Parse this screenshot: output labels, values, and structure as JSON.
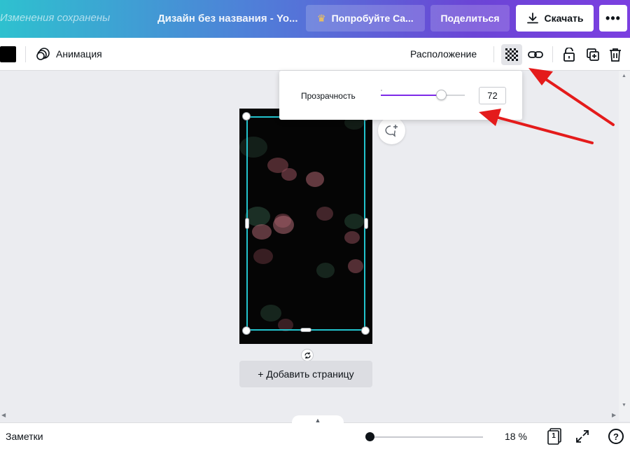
{
  "header": {
    "saved_status": "Изменения сохранены",
    "doc_title": "Дизайн без названия - Yo...",
    "try_button": "Попробуйте Ca...",
    "share_button": "Поделиться",
    "download_button": "Скачать",
    "more_button": "•••"
  },
  "toolbar": {
    "animation_label": "Анимация",
    "arrange_label": "Расположение"
  },
  "transparency_popup": {
    "label": "Прозрачность",
    "value": "72",
    "level": 0.72
  },
  "canvas": {
    "add_page_button": "+ Добавить страницу"
  },
  "bottom_bar": {
    "notes_label": "Заметки",
    "zoom_value": "18 %",
    "page_count": "1",
    "help_label": "?"
  },
  "colors": {
    "accent": "#7d2ae8",
    "selection": "#22c3cd",
    "annotation_arrow": "#e41b1b",
    "swatch": "#000000"
  }
}
